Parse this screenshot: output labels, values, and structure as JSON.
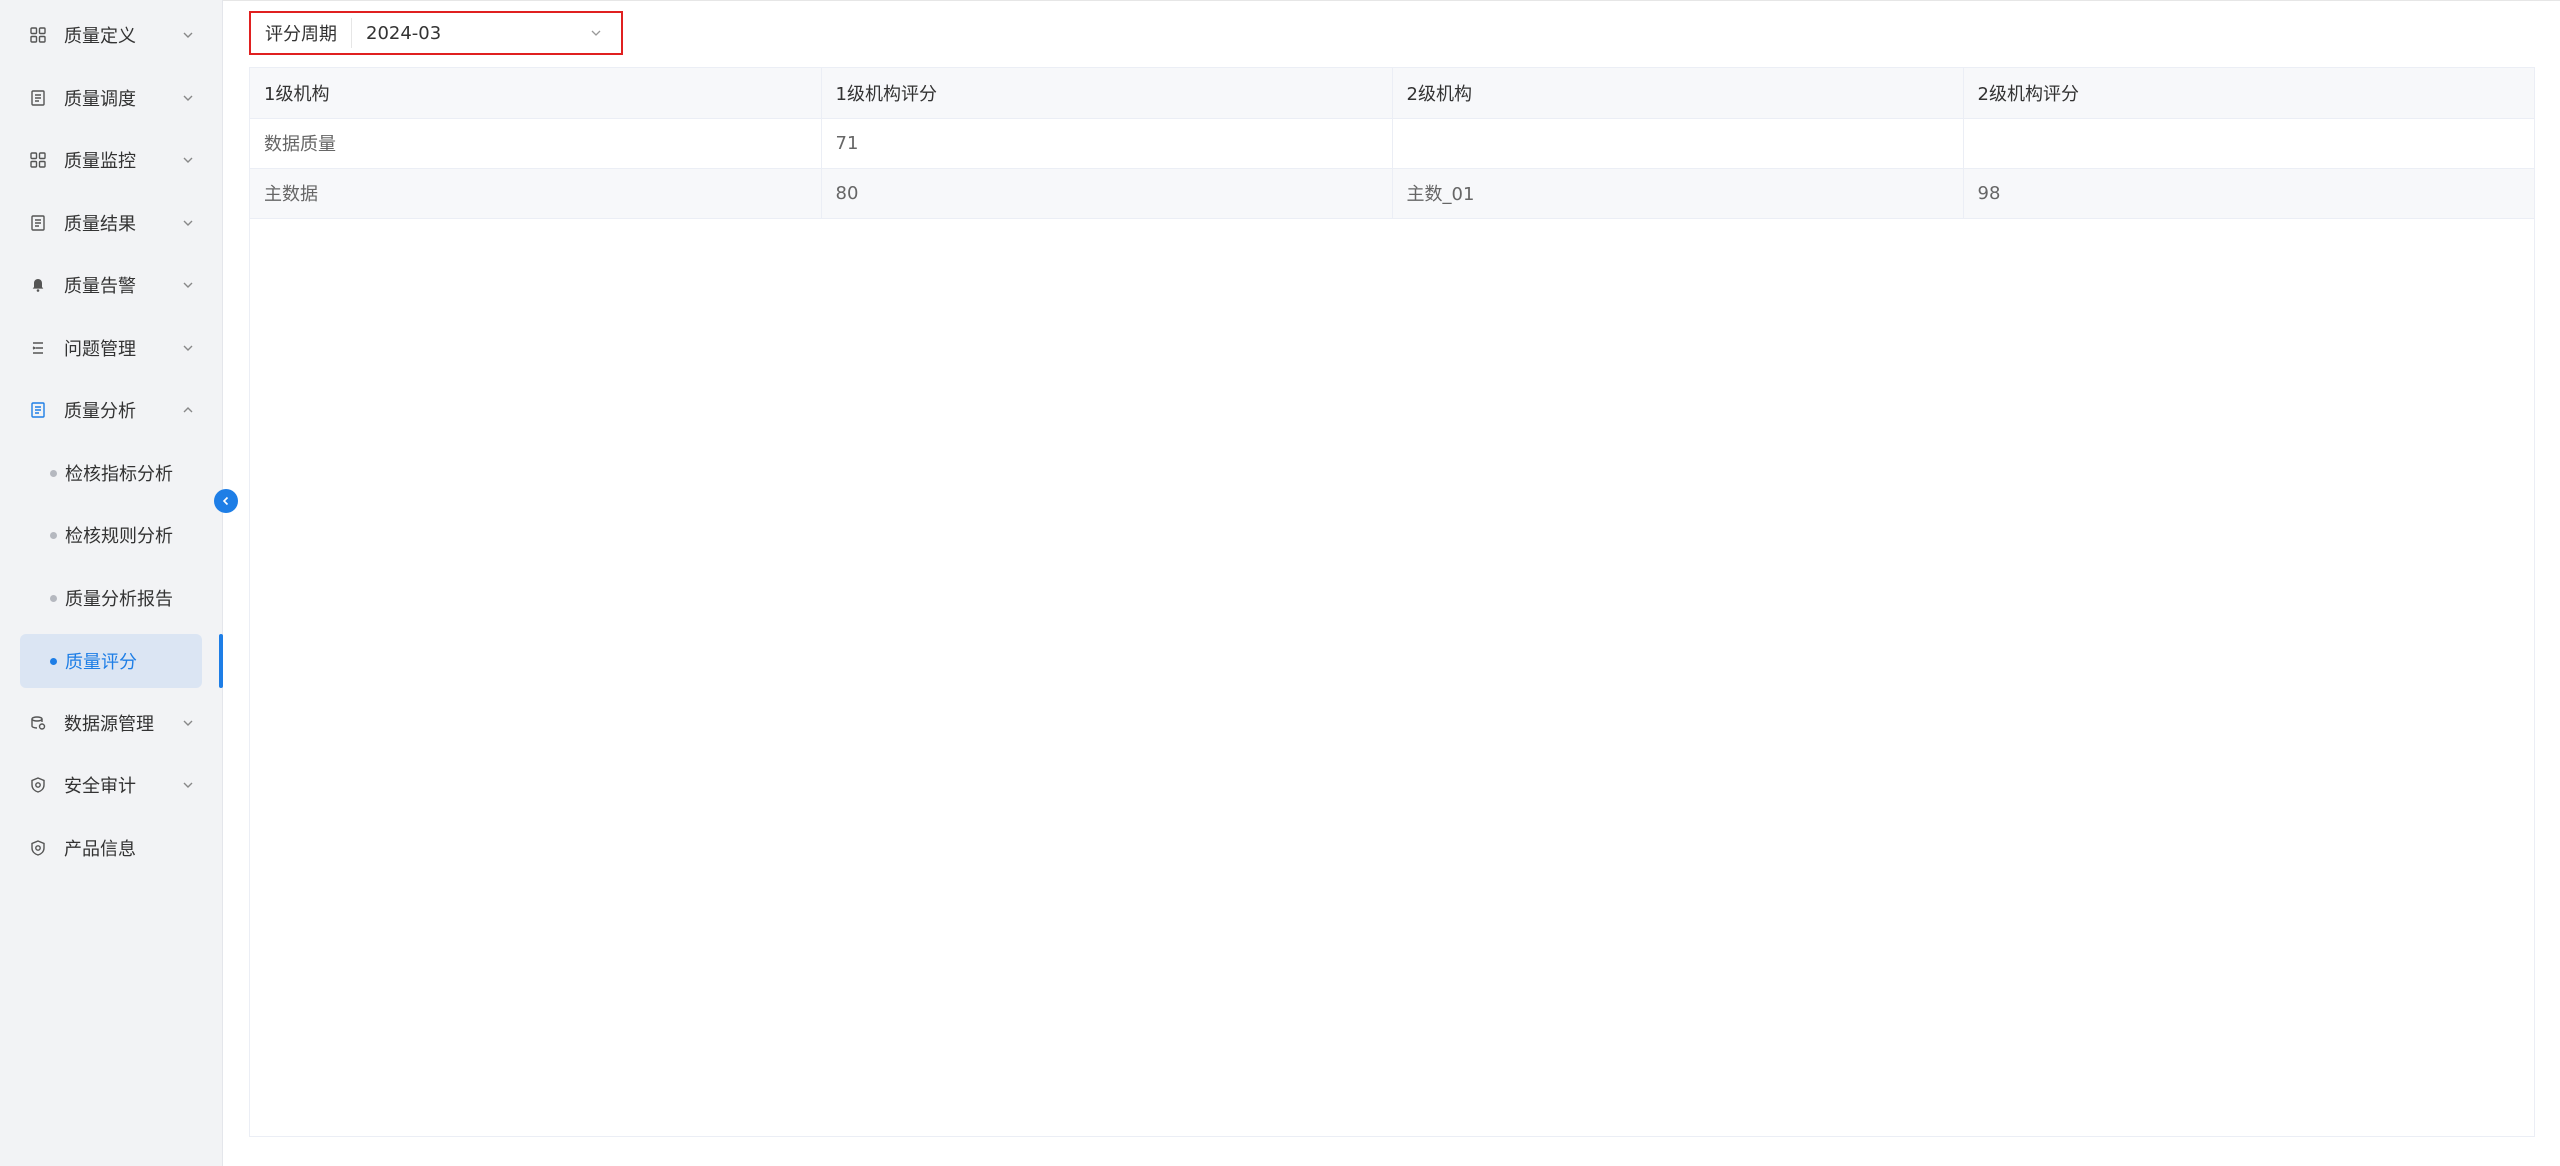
{
  "sidebar": {
    "items": [
      {
        "label": "质量定义",
        "icon": "grid-icon"
      },
      {
        "label": "质量调度",
        "icon": "document-icon"
      },
      {
        "label": "质量监控",
        "icon": "grid-icon"
      },
      {
        "label": "质量结果",
        "icon": "document-icon"
      },
      {
        "label": "质量告警",
        "icon": "bell-icon"
      },
      {
        "label": "问题管理",
        "icon": "list-icon"
      },
      {
        "label": "质量分析",
        "icon": "document-icon"
      },
      {
        "label": "数据源管理",
        "icon": "database-icon"
      },
      {
        "label": "安全审计",
        "icon": "shield-icon"
      },
      {
        "label": "产品信息",
        "icon": "shield-icon"
      }
    ],
    "sub_items": [
      {
        "label": "检核指标分析"
      },
      {
        "label": "检核规则分析"
      },
      {
        "label": "质量分析报告"
      },
      {
        "label": "质量评分",
        "active": true
      }
    ],
    "accent_color": "#1e7ee6"
  },
  "filter": {
    "label": "评分周期",
    "value": "2024-03"
  },
  "table": {
    "columns": [
      "1级机构",
      "1级机构评分",
      "2级机构",
      "2级机构评分"
    ],
    "rows": [
      [
        "数据质量",
        "71",
        "",
        ""
      ],
      [
        "主数据",
        "80",
        "主数_01",
        "98"
      ]
    ]
  }
}
